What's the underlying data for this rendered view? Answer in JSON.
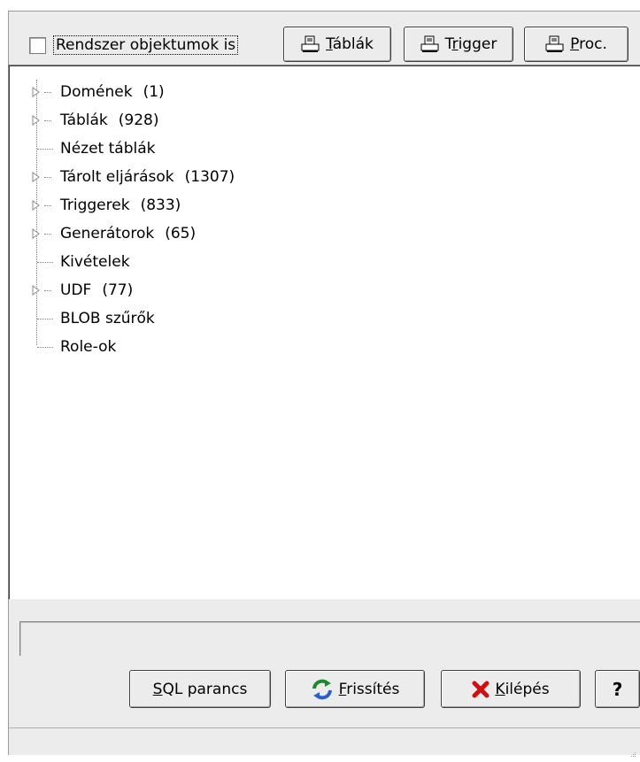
{
  "toolbar": {
    "system_objects_label": "Rendszer objektumok is",
    "tables_button": {
      "prefix": "",
      "mnemonic": "T",
      "rest": "áblák",
      "icon": "printer-icon"
    },
    "trigger_button": {
      "prefix": "T",
      "mnemonic": "r",
      "rest": "igger",
      "icon": "printer-icon"
    },
    "proc_button": {
      "prefix": "",
      "mnemonic": "P",
      "rest": "roc.",
      "icon": "printer-icon"
    }
  },
  "tree": {
    "items": [
      {
        "label": "Domének",
        "count": "(1)",
        "expandable": true
      },
      {
        "label": "Táblák",
        "count": "(928)",
        "expandable": true
      },
      {
        "label": "Nézet táblák",
        "count": "",
        "expandable": false
      },
      {
        "label": "Tárolt eljárások",
        "count": "(1307)",
        "expandable": true
      },
      {
        "label": "Triggerek",
        "count": "(833)",
        "expandable": true
      },
      {
        "label": "Generátorok",
        "count": "(65)",
        "expandable": true
      },
      {
        "label": "Kivételek",
        "count": "",
        "expandable": false
      },
      {
        "label": "UDF",
        "count": "(77)",
        "expandable": true
      },
      {
        "label": "BLOB szűrők",
        "count": "",
        "expandable": false
      },
      {
        "label": "Role-ok",
        "count": "",
        "expandable": false
      }
    ]
  },
  "status": {
    "text": ""
  },
  "actions": {
    "sql_button": {
      "prefix": "",
      "mnemonic": "S",
      "rest": "QL parancs"
    },
    "refresh_button": {
      "prefix": "",
      "mnemonic": "F",
      "rest": "rissítés",
      "icon": "refresh-icon"
    },
    "exit_button": {
      "prefix": "",
      "mnemonic": "K",
      "rest": "ilépés",
      "icon": "close-icon"
    },
    "help_button": {
      "label": "?"
    }
  },
  "colors": {
    "exit_icon": "#d01010",
    "refresh_icon": "#1a8a2a",
    "refresh_icon_alt": "#2b5fd0"
  }
}
